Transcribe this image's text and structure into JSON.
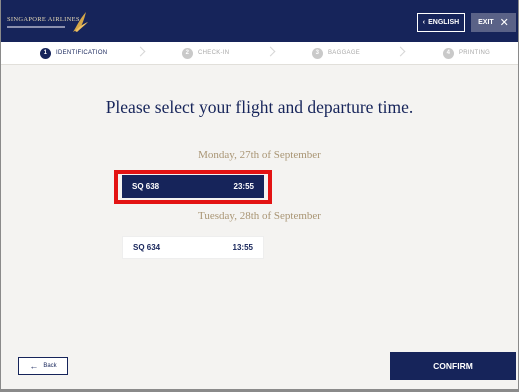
{
  "header": {
    "logo_text": "SINGAPORE AIRLINES",
    "language_label": "ENGLISH",
    "exit_label": "EXIT"
  },
  "steps": [
    {
      "number": "1",
      "label": "IDENTIFICATION",
      "active": true
    },
    {
      "number": "2",
      "label": "CHECK-IN",
      "active": false
    },
    {
      "number": "3",
      "label": "BAGGAGE",
      "active": false
    },
    {
      "number": "4",
      "label": "PRINTING",
      "active": false
    }
  ],
  "main": {
    "title": "Please select your flight and departure time.",
    "groups": [
      {
        "date": "Monday, 27th of September",
        "flight": "SQ 638",
        "time": "23:55",
        "selected": true
      },
      {
        "date": "Tuesday, 28th of September",
        "flight": "SQ 634",
        "time": "13:55",
        "selected": false
      }
    ]
  },
  "footer": {
    "back_label": "Back",
    "confirm_label": "CONFIRM"
  },
  "colors": {
    "navy": "#16245a",
    "gold": "#a99574",
    "highlight_red": "#e31313"
  }
}
